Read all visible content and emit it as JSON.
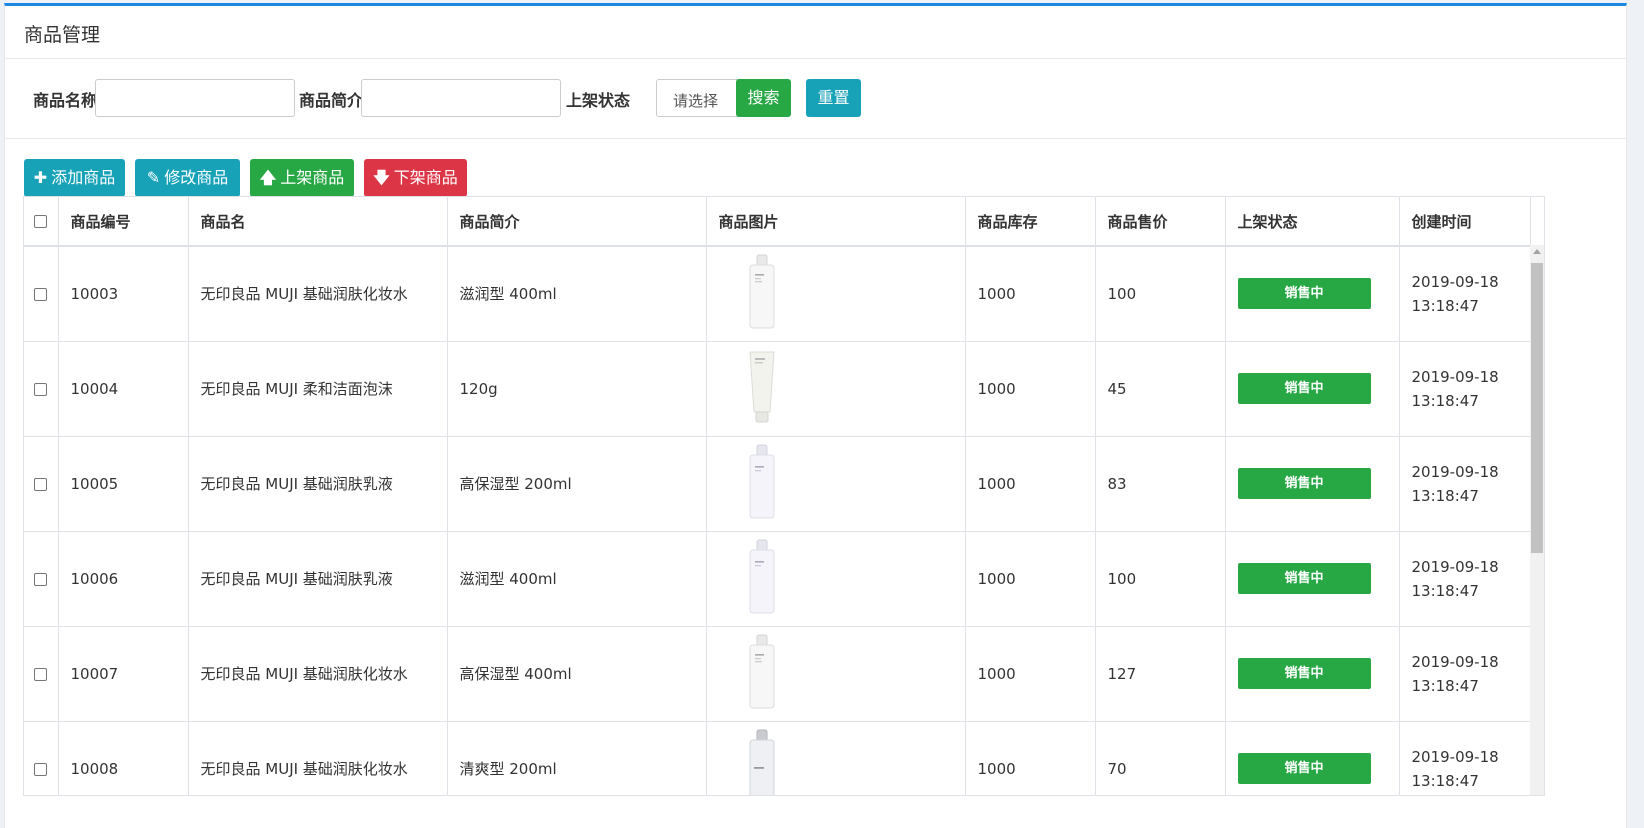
{
  "header": {
    "title": "商品管理"
  },
  "search": {
    "name_label": "商品名称",
    "name_value": "",
    "desc_label": "商品简介",
    "desc_value": "",
    "status_label": "上架状态",
    "status_selected": "请选择",
    "search_button": "搜索",
    "reset_button": "重置"
  },
  "toolbar": {
    "add_label": "添加商品",
    "edit_label": "修改商品",
    "up_label": "上架商品",
    "down_label": "下架商品"
  },
  "table": {
    "columns": [
      "商品编号",
      "商品名",
      "商品简介",
      "商品图片",
      "商品库存",
      "商品售价",
      "上架状态",
      "创建时间"
    ],
    "rows": [
      {
        "id": "10003",
        "name": "无印良品 MUJI 基础润肤化妆水",
        "desc": "滋润型 400ml",
        "image": "toner-bottle-tall",
        "stock": "1000",
        "price": "100",
        "status": "销售中",
        "date": "2019-09-18",
        "time": "13:18:47"
      },
      {
        "id": "10004",
        "name": "无印良品 MUJI 柔和洁面泡沫",
        "desc": "120g",
        "image": "cleanser-tube",
        "stock": "1000",
        "price": "45",
        "status": "销售中",
        "date": "2019-09-18",
        "time": "13:18:47"
      },
      {
        "id": "10005",
        "name": "无印良品 MUJI 基础润肤乳液",
        "desc": "高保湿型 200ml",
        "image": "lotion-bottle",
        "stock": "1000",
        "price": "83",
        "status": "销售中",
        "date": "2019-09-18",
        "time": "13:18:47"
      },
      {
        "id": "10006",
        "name": "无印良品 MUJI 基础润肤乳液",
        "desc": "滋润型 400ml",
        "image": "lotion-bottle",
        "stock": "1000",
        "price": "100",
        "status": "销售中",
        "date": "2019-09-18",
        "time": "13:18:47"
      },
      {
        "id": "10007",
        "name": "无印良品 MUJI 基础润肤化妆水",
        "desc": "高保湿型 400ml",
        "image": "toner-bottle-tall",
        "stock": "1000",
        "price": "127",
        "status": "销售中",
        "date": "2019-09-18",
        "time": "13:18:47"
      },
      {
        "id": "10008",
        "name": "无印良品 MUJI 基础润肤化妆水",
        "desc": "清爽型 200ml",
        "image": "toner-bottle-clear",
        "stock": "1000",
        "price": "70",
        "status": "销售中",
        "date": "2019-09-18",
        "time": "13:18:47"
      }
    ]
  },
  "colors": {
    "accent": "#1e88e5",
    "green": "#28a745",
    "cyan": "#17a2b8",
    "red": "#dc3545"
  }
}
